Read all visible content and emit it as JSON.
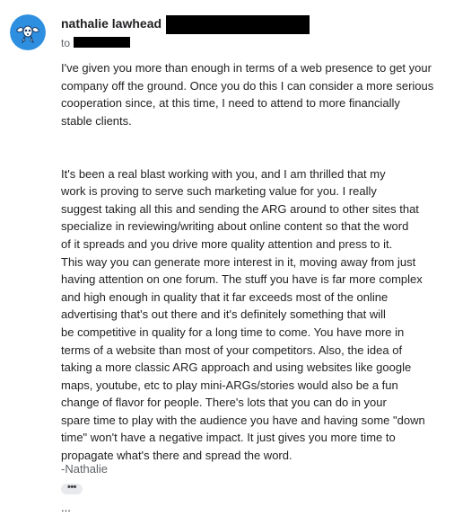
{
  "message": {
    "sender_name": "nathalie lawhead",
    "to_label": "to",
    "paragraphs": [
      [
        "I've given you more than enough in terms of a web presence to get your",
        "company off the ground. Once you do this I can consider a more serious",
        "cooperation since, at this time, I need to attend to more financially",
        "stable clients."
      ],
      [
        "It's been a real blast working with you, and I am thrilled that my",
        "work is proving to serve such marketing value for you. I really",
        "suggest taking all this and sending the ARG around to other sites that",
        "specialize in reviewing/writing about online content so that the word",
        "of it spreads and you drive more quality attention and press to it.",
        "This way you can generate more interest in it, moving away from just",
        "having attention on one forum. The stuff you have is far more complex",
        "and high enough in quality that it far exceeds most of the online",
        "advertising that's out there and it's definitely something that will",
        "be competitive in quality for a long time to come. You have more in",
        "terms of a website than most of your competitors. Also, the idea of",
        "taking a more classic ARG approach and using websites like google",
        "maps, youtube, etc to play mini-ARGs/stories would also be a fun",
        "change of flavor for people. There's lots that you can do in your",
        "spare time to play with the audience you have and having some \"down",
        "time\" won't have a negative impact. It just gives you more time to",
        "propagate what's there and spread the word."
      ]
    ],
    "signature": "-Nathalie",
    "more_button_label": "•••",
    "trailing_text": "..."
  },
  "colors": {
    "avatar_background": "#2e8fe0",
    "avatar_figure": "#ffffff",
    "redaction": "#000000"
  },
  "icons": {
    "avatar": "avatar-icon"
  }
}
